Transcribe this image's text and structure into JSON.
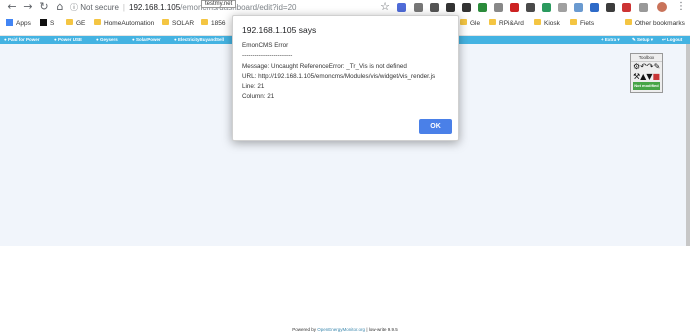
{
  "browser": {
    "tooltip": "testmy.net",
    "security_label": "Not secure",
    "url_host": "192.168.1.105",
    "url_path": "/emoncms/dashboard/edit?id=20"
  },
  "bookmarks": {
    "apps_label": "Apps",
    "items": [
      "S",
      "GE",
      "HomeAutomation",
      "SOLAR",
      "1856",
      "Gle",
      "RPi&Ard",
      "Kiosk",
      "Fiets"
    ],
    "other_label": "Other bookmarks"
  },
  "appbar": {
    "menu": [
      "Paid for Power",
      "Power USE",
      "Geysers",
      "SolarPower",
      "ElectricityBuyandSell"
    ],
    "extra_label": "Extra",
    "setup_label": "Setup",
    "logout_label": "Logout"
  },
  "toolbox": {
    "title": "Toolbox",
    "status": "Not modified"
  },
  "dialog": {
    "title": "192.168.1.105 says",
    "message": "EmonCMS Error\n------------------------\nMessage: Uncaught ReferenceError: _Tr_Vis is not defined\nURL: http://192.168.1.105/emoncms/Modules/vis/widget/vis_render.js\nLine: 21\nColumn: 21",
    "ok_label": "OK"
  },
  "footer": {
    "prefix": "Powered by",
    "link": "OpenEnergyMonitor.org",
    "suffix": "| low-write 9.9.5"
  },
  "colors": {
    "appbar": "#44b3e2",
    "ok_button": "#4a80e8",
    "content_bg": "#f1f5fb",
    "not_modified": "#46a546"
  }
}
